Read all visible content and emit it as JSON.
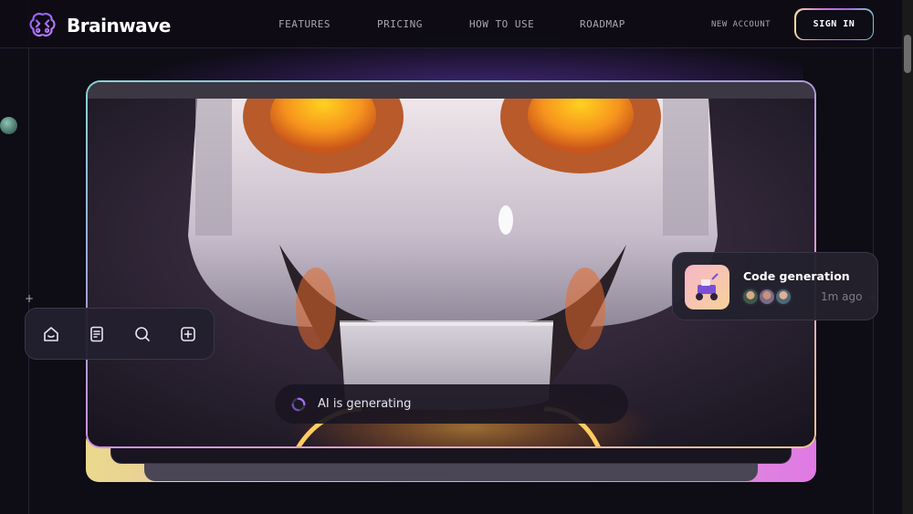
{
  "brand": {
    "name": "Brainwave",
    "logo_icon": "brain-icon",
    "accent": "#a470f0"
  },
  "nav": {
    "items": [
      {
        "label": "FEATURES"
      },
      {
        "label": "PRICING"
      },
      {
        "label": "HOW TO USE"
      },
      {
        "label": "ROADMAP"
      }
    ],
    "new_account": "NEW ACCOUNT",
    "sign_in": "SIGN IN"
  },
  "hero": {
    "generating_text": "AI is generating",
    "spinner_icon": "loading-spinner-icon",
    "toolbar_icons": [
      "home-icon",
      "document-icon",
      "search-icon",
      "add-square-icon"
    ]
  },
  "code_card": {
    "title": "Code generation",
    "time": "1m ago",
    "thumbnail_icon": "robot-rover-image"
  },
  "colors": {
    "background": "#0e0c15",
    "frame_gradient": [
      "#86d6d0",
      "#d28fe0",
      "#e7c98a"
    ],
    "robot_eyes": "#f7941d"
  }
}
